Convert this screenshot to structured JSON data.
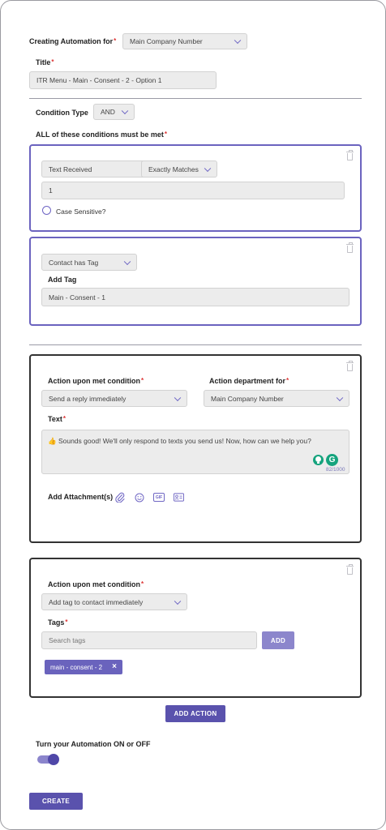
{
  "header": {
    "creating_label": "Creating Automation for",
    "company_value": "Main Company Number"
  },
  "title_section": {
    "label": "Title",
    "value": "ITR Menu - Main - Consent - 2 - Option 1"
  },
  "conditions": {
    "type_label": "Condition Type",
    "type_value": "AND",
    "all_label": "ALL of these conditions must be met",
    "card1": {
      "trigger": "Text Received",
      "match": "Exactly Matches",
      "value": "1",
      "case_label": "Case Sensitive?"
    },
    "card2": {
      "trigger": "Contact has Tag",
      "tag_label": "Add Tag",
      "tag_value": "Main - Consent - 1"
    }
  },
  "action1": {
    "action_label": "Action upon met condition",
    "action_value": "Send a reply immediately",
    "dept_label": "Action department for",
    "dept_value": "Main Company Number",
    "text_label": "Text",
    "text_value": "👍 Sounds good! We'll only respond to texts you send us! Now, how can we help you?",
    "char_count": "82/1000",
    "attach_label": "Add Attachment(s)",
    "gif_label": "GIF"
  },
  "action2": {
    "action_label": "Action upon met condition",
    "action_value": "Add tag to contact immediately",
    "tags_label": "Tags",
    "tags_placeholder": "Search tags",
    "add_label": "ADD",
    "tag_chip": "main - consent - 2",
    "tag_remove": "×"
  },
  "footer": {
    "add_action_label": "ADD ACTION",
    "toggle_label": "Turn your Automation ON or OFF",
    "toggle_on": true,
    "create_label": "CREATE"
  },
  "colors": {
    "accent": "#5a52ad",
    "card_border_active": "#6b63bf",
    "required": "#dd3333"
  }
}
